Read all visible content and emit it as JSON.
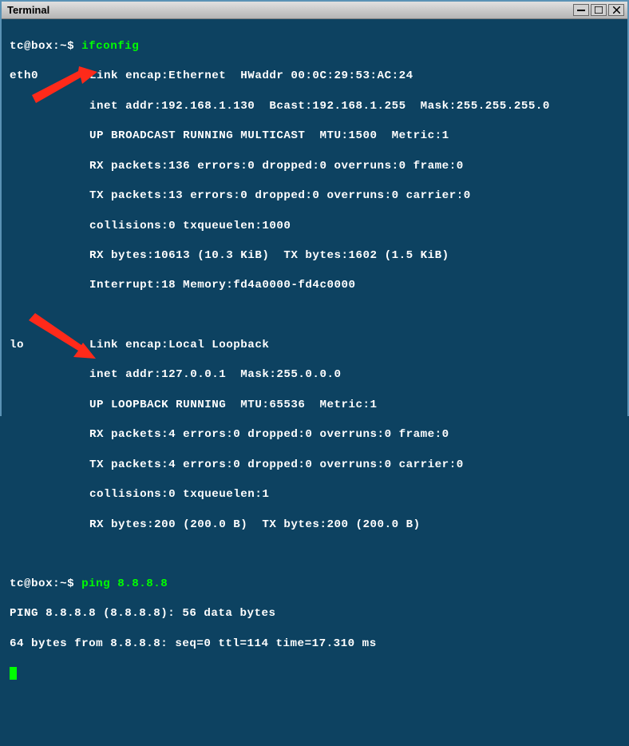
{
  "titlebar": {
    "title": "Terminal",
    "min": "—",
    "max": "☐",
    "close": "✕"
  },
  "prompt1": {
    "prefix": "tc@box:~$ ",
    "cmd": "ifconfig"
  },
  "eth0": {
    "name": "eth0",
    "l1": "Link encap:Ethernet  HWaddr 00:0C:29:53:AC:24",
    "l2": "inet addr:192.168.1.130  Bcast:192.168.1.255  Mask:255.255.255.0",
    "l3": "UP BROADCAST RUNNING MULTICAST  MTU:1500  Metric:1",
    "l4": "RX packets:136 errors:0 dropped:0 overruns:0 frame:0",
    "l5": "TX packets:13 errors:0 dropped:0 overruns:0 carrier:0",
    "l6": "collisions:0 txqueuelen:1000",
    "l7": "RX bytes:10613 (10.3 KiB)  TX bytes:1602 (1.5 KiB)",
    "l8": "Interrupt:18 Memory:fd4a0000-fd4c0000"
  },
  "lo": {
    "name": "lo",
    "l1": "Link encap:Local Loopback",
    "l2": "inet addr:127.0.0.1  Mask:255.0.0.0",
    "l3": "UP LOOPBACK RUNNING  MTU:65536  Metric:1",
    "l4": "RX packets:4 errors:0 dropped:0 overruns:0 frame:0",
    "l5": "TX packets:4 errors:0 dropped:0 overruns:0 carrier:0",
    "l6": "collisions:0 txqueuelen:1",
    "l7": "RX bytes:200 (200.0 B)  TX bytes:200 (200.0 B)"
  },
  "prompt2": {
    "prefix": "tc@box:~$ ",
    "cmd": "ping 8.8.8.8"
  },
  "ping": {
    "l1": "PING 8.8.8.8 (8.8.8.8): 56 data bytes",
    "l2": "64 bytes from 8.8.8.8: seq=0 ttl=114 time=17.310 ms"
  }
}
